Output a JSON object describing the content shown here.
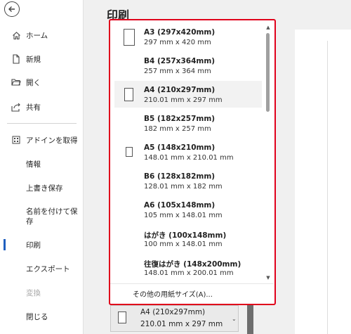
{
  "title": "印刷",
  "sidebar": {
    "items": [
      {
        "label": "ホーム",
        "icon": "home-icon"
      },
      {
        "label": "新規",
        "icon": "new-document-icon"
      },
      {
        "label": "開く",
        "icon": "folder-open-icon"
      },
      {
        "label": "共有",
        "icon": "share-icon"
      },
      {
        "label": "アドインを取得",
        "icon": "grid-icon"
      },
      {
        "label": "情報"
      },
      {
        "label": "上書き保存"
      },
      {
        "label": "名前を付けて保存"
      },
      {
        "label": "印刷"
      },
      {
        "label": "エクスポート"
      },
      {
        "label": "変換"
      },
      {
        "label": "閉じる"
      }
    ]
  },
  "paper_sizes": [
    {
      "name": "A3 (297x420mm)",
      "dims": "297 mm x 420 mm"
    },
    {
      "name": "B4 (257x364mm)",
      "dims": "257 mm x 364 mm"
    },
    {
      "name": "A4 (210x297mm)",
      "dims": "210.01 mm x 297 mm"
    },
    {
      "name": "B5 (182x257mm)",
      "dims": "182 mm x 257 mm"
    },
    {
      "name": "A5 (148x210mm)",
      "dims": "148.01 mm x 210.01 mm"
    },
    {
      "name": "B6 (128x182mm)",
      "dims": "128.01 mm x 182 mm"
    },
    {
      "name": "A6 (105x148mm)",
      "dims": "105 mm x 148.01 mm"
    },
    {
      "name": "はがき (100x148mm)",
      "dims": "100 mm x 148.01 mm"
    },
    {
      "name": "往復はがき (148x200mm)",
      "dims": "148.01 mm x 200.01 mm"
    }
  ],
  "more_sizes_label": "その他の用紙サイズ(A)...",
  "selected": {
    "name": "A4 (210x297mm)",
    "dims": "210.01 mm x 297 mm"
  },
  "colors": {
    "highlight_border": "#e0001b",
    "active_accent": "#1f5fbf"
  }
}
